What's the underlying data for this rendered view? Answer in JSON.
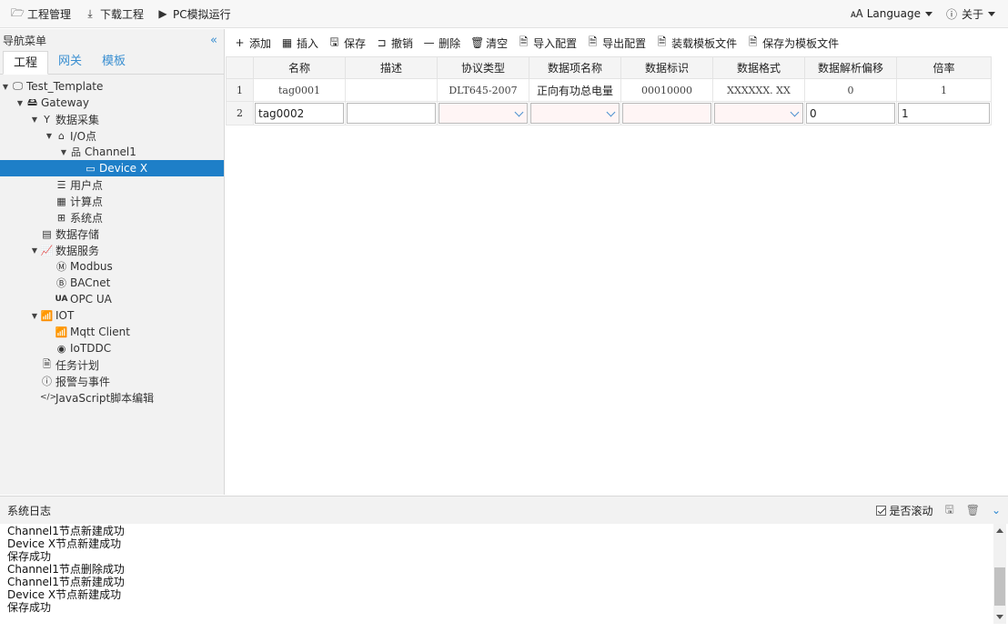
{
  "topbar": {
    "items": [
      {
        "label": "工程管理"
      },
      {
        "label": "下载工程"
      },
      {
        "label": "PC模拟运行"
      }
    ],
    "language_label": "Language",
    "about_label": "关于"
  },
  "sidebar": {
    "title": "导航菜单",
    "tabs": [
      {
        "label": "工程"
      },
      {
        "label": "网关"
      },
      {
        "label": "模板"
      }
    ],
    "tree": [
      {
        "label": "Test_Template"
      },
      {
        "label": "Gateway"
      },
      {
        "label": "数据采集"
      },
      {
        "label": "I/O点"
      },
      {
        "label": "Channel1"
      },
      {
        "label": "Device X"
      },
      {
        "label": "用户点"
      },
      {
        "label": "计算点"
      },
      {
        "label": "系统点"
      },
      {
        "label": "数据存储"
      },
      {
        "label": "数据服务"
      },
      {
        "label": "Modbus"
      },
      {
        "label": "BACnet"
      },
      {
        "label": "OPC UA"
      },
      {
        "label": "IOT"
      },
      {
        "label": "Mqtt Client"
      },
      {
        "label": "IoTDDC"
      },
      {
        "label": "任务计划"
      },
      {
        "label": "报警与事件"
      },
      {
        "label": "JavaScript脚本编辑"
      }
    ]
  },
  "toolbar": {
    "buttons": [
      {
        "label": "添加"
      },
      {
        "label": "插入"
      },
      {
        "label": "保存"
      },
      {
        "label": "撤销"
      },
      {
        "label": "删除"
      },
      {
        "label": "清空"
      },
      {
        "label": "导入配置"
      },
      {
        "label": "导出配置"
      },
      {
        "label": "装载模板文件"
      },
      {
        "label": "保存为模板文件"
      }
    ]
  },
  "table": {
    "headers": [
      "名称",
      "描述",
      "协议类型",
      "数据项名称",
      "数据标识",
      "数据格式",
      "数据解析偏移",
      "倍率"
    ],
    "rows": [
      {
        "num": "1",
        "cells": [
          "tag0001",
          "",
          "DLT645-2007",
          "正向有功总电量",
          "00010000",
          "XXXXXX. XX",
          "0",
          "1"
        ]
      },
      {
        "num": "2",
        "cells": [
          "tag0002",
          "",
          "",
          "",
          "",
          "",
          "0",
          "1"
        ]
      }
    ]
  },
  "log": {
    "title": "系统日志",
    "autoscroll_label": "是否滚动",
    "lines": [
      "Channel1节点新建成功",
      "Device X节点新建成功",
      "保存成功",
      "Channel1节点删除成功",
      "Channel1节点新建成功",
      "Device X节点新建成功",
      "保存成功"
    ]
  }
}
